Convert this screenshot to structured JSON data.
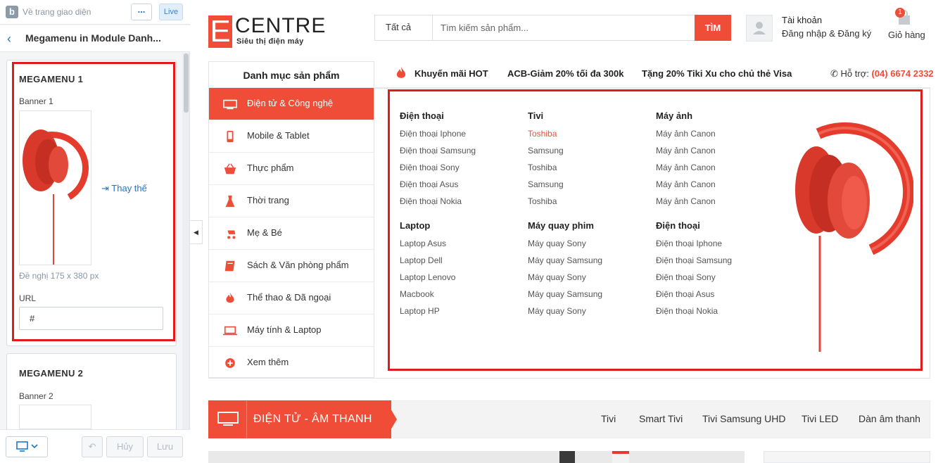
{
  "editor": {
    "title": "Về trang giao diện",
    "more_label": "...",
    "live_label": "Live",
    "section_title": "Megamenu in Module Danh...",
    "cards": [
      {
        "title": "MEGAMENU 1",
        "banner_label": "Banner 1",
        "replace_label": "Thay thế",
        "size_hint": "Đề nghị 175 x 380 px",
        "url_label": "URL",
        "url_value": "#"
      },
      {
        "title": "MEGAMENU 2",
        "banner_label": "Banner 2"
      }
    ],
    "undo_label": "",
    "cancel_label": "Hủy",
    "save_label": "Lưu",
    "accent": "#1f76c6",
    "highlight": "#e01b1b"
  },
  "store": {
    "brand_letter": "E",
    "brand_name": "CENTRE",
    "brand_tagline": "Siêu thị điện máy",
    "search_category": "Tất cả",
    "search_placeholder": "Tìm kiếm sản phẩm...",
    "search_button": "TÌM",
    "account_title": "Tài khoản",
    "account_sub": "Đăng nhập & Đăng ký",
    "cart_count": "1",
    "cart_label": "Giỏ hàng",
    "accent": "#ef4d38"
  },
  "nav": {
    "category_heading": "Danh mục sản phẩm",
    "links": [
      "Khuyến mãi HOT",
      "ACB-Giảm 20% tối đa 300k",
      "Tặng 20% Tiki Xu cho chủ thẻ Visa"
    ],
    "support_label": "Hỗ trợ:",
    "support_phone": "(04) 6674 2332"
  },
  "categories": [
    {
      "label": "Điện tử & Công nghệ",
      "icon": "monitor-icon",
      "active": true
    },
    {
      "label": "Mobile & Tablet",
      "icon": "phone-icon"
    },
    {
      "label": "Thực phẩm",
      "icon": "basket-icon"
    },
    {
      "label": "Thời trang",
      "icon": "dress-icon"
    },
    {
      "label": "Mẹ & Bé",
      "icon": "stroller-icon"
    },
    {
      "label": "Sách & Văn phòng phẩm",
      "icon": "book-icon"
    },
    {
      "label": "Thể thao & Dã ngoại",
      "icon": "flame-icon"
    },
    {
      "label": "Máy tính & Laptop",
      "icon": "laptop-icon"
    },
    {
      "label": "Xem thêm",
      "icon": "plus-circle-icon"
    }
  ],
  "megamenu": {
    "groups": [
      {
        "title": "Điện thoại",
        "links": [
          "Điện thoại Iphone",
          "Điện thoại Samsung",
          "Điện thoại Sony",
          "Điện thoại Asus",
          "Điện thoại Nokia"
        ]
      },
      {
        "title": "Tivi",
        "links": [
          "Toshiba",
          "Samsung",
          "Toshiba",
          "Samsung",
          "Toshiba"
        ]
      },
      {
        "title": "Máy ảnh",
        "links": [
          "Máy ảnh Canon",
          "Máy ảnh Canon",
          "Máy ảnh Canon",
          "Máy ảnh Canon",
          "Máy ảnh Canon"
        ]
      },
      {
        "title": "Laptop",
        "links": [
          "Laptop Asus",
          "Laptop Dell",
          "Laptop Lenovo",
          "Macbook",
          "Laptop HP"
        ]
      },
      {
        "title": "Máy quay phim",
        "links": [
          "Máy quay Sony",
          "Máy quay Samsung",
          "Máy quay Sony",
          "Máy quay Samsung",
          "Máy quay Sony"
        ]
      },
      {
        "title": "Điện thoại",
        "links": [
          "Điện thoại Iphone",
          "Điện thoại Samsung",
          "Điện thoại Sony",
          "Điện thoại Asus",
          "Điện thoại Nokia"
        ]
      }
    ],
    "hover_link": "Toshiba"
  },
  "section": {
    "title": "ĐIỆN TỬ - ÂM THANH",
    "links": [
      "Tivi",
      "Smart Tivi",
      "Tivi Samsung UHD",
      "Tivi LED",
      "Dàn âm thanh"
    ]
  }
}
